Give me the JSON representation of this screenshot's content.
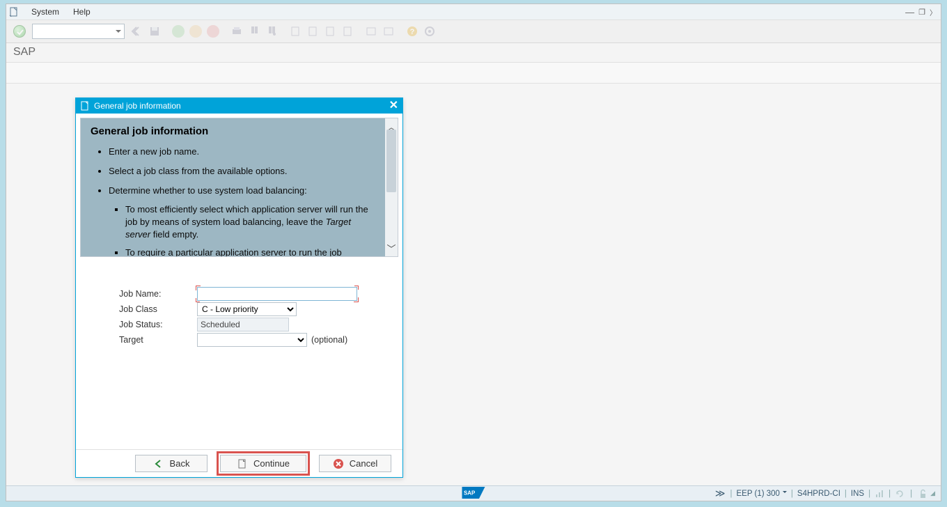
{
  "menu": {
    "system": "System",
    "help": "Help"
  },
  "app_title": "SAP",
  "dialog": {
    "title": "General job information",
    "info_heading": "General job information",
    "bullet1": "Enter a new job name.",
    "bullet2": "Select a job class from the available options.",
    "bullet3": "Determine whether to use system load balancing:",
    "sub1_a": "To most efficiently select which application server will run the job by means of system load balancing, leave the ",
    "sub1_b": "Target server",
    "sub1_c": " field empty.",
    "sub2": "To require a particular application server to run the job",
    "form": {
      "job_name_label": "Job Name:",
      "job_name_value": "",
      "job_class_label": "Job Class",
      "job_class_value": "C - Low priority",
      "job_status_label": "Job Status:",
      "job_status_value": "Scheduled",
      "target_label": "Target",
      "target_value": "",
      "optional": "(optional)"
    },
    "buttons": {
      "back": "Back",
      "continue": "Continue",
      "cancel": "Cancel"
    }
  },
  "status": {
    "system": "EEP (1) 300",
    "server": "S4HPRD-CI",
    "mode": "INS"
  }
}
